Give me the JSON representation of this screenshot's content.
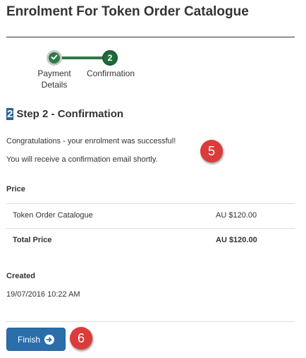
{
  "page": {
    "title": "Enrolment For Token Order Catalogue"
  },
  "wizard": {
    "steps": [
      {
        "label_line1": "Payment",
        "label_line2": "Details",
        "state": "complete",
        "icon": "check-icon"
      },
      {
        "number": "2",
        "label": "Confirmation",
        "state": "current"
      }
    ],
    "active_color": "#2f7a45"
  },
  "step": {
    "number": "2",
    "heading": "Step 2 - Confirmation"
  },
  "messages": {
    "success": "Congratulations - your enrolment was successful!",
    "email": "You will receive a confirmation email shortly."
  },
  "annotations": {
    "badge_a": "5",
    "badge_b": "6",
    "color": "#dc3b3b"
  },
  "price": {
    "label": "Price",
    "rows": [
      {
        "name": "Token Order Catalogue",
        "amount": "AU $120.00"
      },
      {
        "name": "Total Price",
        "amount": "AU $120.00"
      }
    ]
  },
  "created": {
    "label": "Created",
    "value": "19/07/2016 10:22 AM"
  },
  "actions": {
    "finish_label": "Finish",
    "finish_icon": "arrow-circle-right-icon",
    "button_color": "#2a6eaa"
  }
}
